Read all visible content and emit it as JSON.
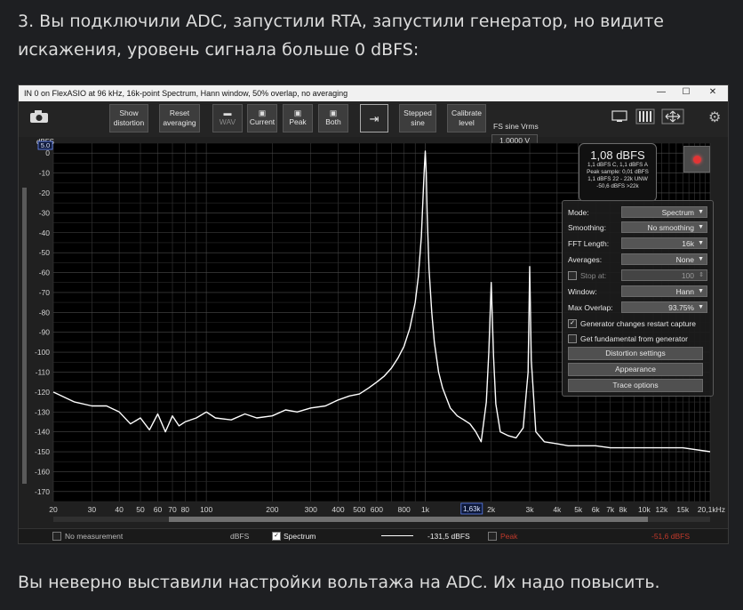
{
  "page": {
    "heading": "3. Вы подключили ADC, запустили RTA, запустили генератор, но видите искажения, уровень сигнала больше 0 dBFS:",
    "footer": "Вы неверно выставили настройки вольтажа на ADC. Их надо повысить."
  },
  "window": {
    "title": "IN 0 on FlexASIO at 96 kHz, 16k-point Spectrum, Hann window, 50% overlap, no averaging",
    "controls": {
      "minimize": "—",
      "maximize": "☐",
      "close": "✕"
    }
  },
  "toolbar": {
    "show_distortion": [
      "Show",
      "distortion"
    ],
    "reset_averaging": [
      "Reset",
      "averaging"
    ],
    "wav": "WAV",
    "current": "Current",
    "peak": "Peak",
    "both": "Both",
    "stepped_sine": [
      "Stepped",
      "sine"
    ],
    "calibrate_level": [
      "Calibrate",
      "level"
    ],
    "fs_label": "FS sine Vrms",
    "fs_value": "1,0000 V"
  },
  "readout": {
    "main": "1,08 dBFS",
    "lines": [
      "1,1 dBFS C, 1,1 dBFS A",
      "Peak sample: 0,01 dBFS",
      "1,1 dBFS 22 - 22k UNW",
      "-50,6 dBFS >22k"
    ]
  },
  "panel": {
    "mode_label": "Mode:",
    "mode_value": "Spectrum",
    "smoothing_label": "Smoothing:",
    "smoothing_value": "No smoothing",
    "fft_label": "FFT Length:",
    "fft_value": "16k",
    "averages_label": "Averages:",
    "averages_value": "None",
    "stop_label": "Stop at:",
    "stop_value": "100",
    "window_label": "Window:",
    "window_value": "Hann",
    "overlap_label": "Max Overlap:",
    "overlap_value": "93.75%",
    "gen_restart": "Generator changes restart capture",
    "get_fundamental": "Get fundamental from generator",
    "distortion_settings": "Distortion settings",
    "appearance": "Appearance",
    "trace_options": "Trace options"
  },
  "status": {
    "no_measurement": "No measurement",
    "unit": "dBFS",
    "spectrum": "Spectrum",
    "spectrum_value": "-131,5 dBFS",
    "peak": "Peak",
    "peak_value": "-51,6 dBFS"
  },
  "chart_data": {
    "type": "line",
    "ylabel": "dBFS",
    "ylim": [
      -175,
      5
    ],
    "yticks": [
      0,
      -10,
      -20,
      -30,
      -40,
      -50,
      -60,
      -70,
      -80,
      -90,
      -100,
      -110,
      -120,
      -130,
      -140,
      -150,
      -160,
      -170
    ],
    "xscale": "log",
    "xlim": [
      20,
      20000
    ],
    "xticks": [
      {
        "v": 20,
        "t": "20"
      },
      {
        "v": 30,
        "t": "30"
      },
      {
        "v": 40,
        "t": "40"
      },
      {
        "v": 50,
        "t": "50"
      },
      {
        "v": 60,
        "t": "60"
      },
      {
        "v": 70,
        "t": "70"
      },
      {
        "v": 80,
        "t": "80"
      },
      {
        "v": 100,
        "t": "100"
      },
      {
        "v": 200,
        "t": "200"
      },
      {
        "v": 300,
        "t": "300"
      },
      {
        "v": 400,
        "t": "400"
      },
      {
        "v": 500,
        "t": "500"
      },
      {
        "v": 600,
        "t": "600"
      },
      {
        "v": 800,
        "t": "800"
      },
      {
        "v": 1000,
        "t": "1k"
      },
      {
        "v": 2000,
        "t": "2k"
      },
      {
        "v": 3000,
        "t": "3k"
      },
      {
        "v": 4000,
        "t": "4k"
      },
      {
        "v": 5000,
        "t": "5k"
      },
      {
        "v": 6000,
        "t": "6k"
      },
      {
        "v": 7000,
        "t": "7k"
      },
      {
        "v": 8000,
        "t": "8k"
      },
      {
        "v": 10000,
        "t": "10k"
      },
      {
        "v": 12000,
        "t": "12k"
      },
      {
        "v": 15000,
        "t": "15k"
      },
      {
        "v": 20000,
        "t": "20,1kHz"
      }
    ],
    "cursor_label": "1,63k",
    "cursor_x": 1630,
    "scale_box": "5.0",
    "series": [
      {
        "x": [
          20,
          25,
          30,
          35,
          40,
          45,
          50,
          55,
          60,
          65,
          70,
          75,
          80,
          90,
          100,
          110,
          130,
          150,
          170,
          200,
          230,
          260,
          300,
          350,
          400,
          450,
          500,
          550,
          600,
          650,
          700,
          750,
          800,
          850,
          900,
          930,
          960,
          980,
          990,
          1000,
          1010,
          1020,
          1040,
          1070,
          1100,
          1150,
          1200,
          1300,
          1400,
          1500,
          1600,
          1700,
          1800,
          1900,
          1950,
          2000,
          2050,
          2100,
          2200,
          2400,
          2600,
          2800,
          2950,
          3000,
          3050,
          3200,
          3500,
          4000,
          4500,
          5000,
          6000,
          7000,
          8000,
          9000,
          10000,
          12000,
          15000,
          20000
        ],
        "y": [
          -120,
          -125,
          -127,
          -127,
          -130,
          -136,
          -133,
          -139,
          -131,
          -140,
          -132,
          -137,
          -135,
          -133,
          -130,
          -133,
          -134,
          -131,
          -133,
          -132,
          -129,
          -130,
          -128,
          -127,
          -124,
          -122,
          -121,
          -118,
          -115,
          -112,
          -108,
          -103,
          -97,
          -88,
          -75,
          -62,
          -42,
          -18,
          -8,
          1,
          -10,
          -30,
          -58,
          -80,
          -95,
          -110,
          -118,
          -128,
          -132,
          -134,
          -136,
          -140,
          -145,
          -125,
          -100,
          -65,
          -102,
          -126,
          -140,
          -142,
          -143,
          -138,
          -110,
          -57,
          -104,
          -140,
          -145,
          -146,
          -147,
          -147,
          -147,
          -148,
          -148,
          -148,
          -148,
          -148,
          -148,
          -150
        ]
      }
    ]
  }
}
